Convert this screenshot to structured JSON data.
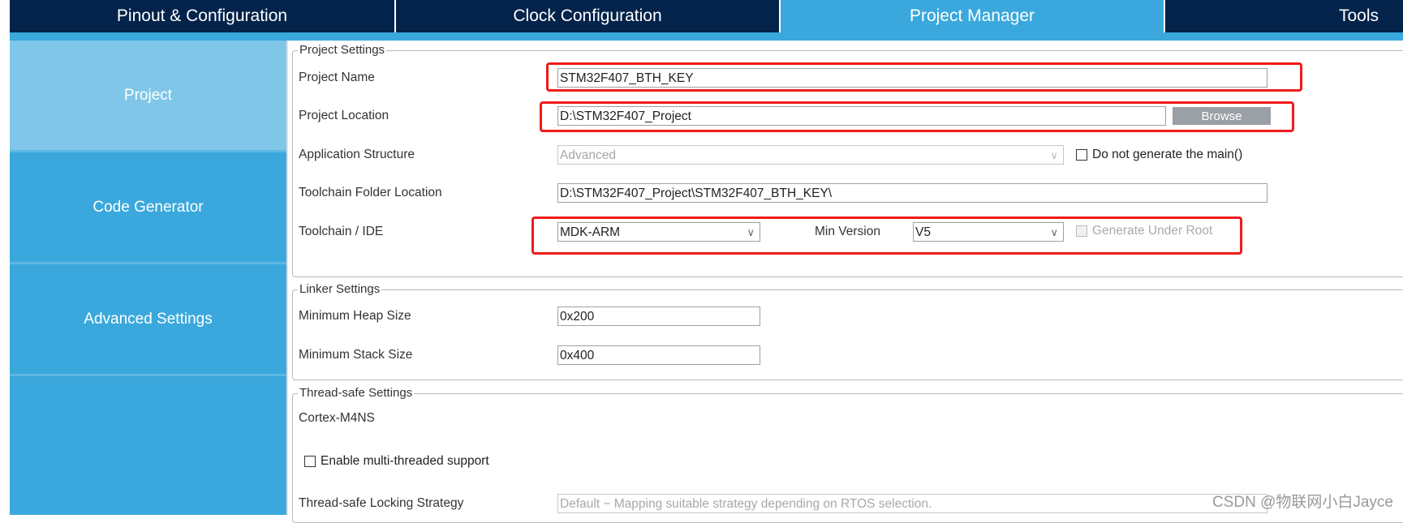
{
  "tabs": [
    {
      "label": "Pinout & Configuration"
    },
    {
      "label": "Clock Configuration"
    },
    {
      "label": "Project Manager",
      "active": true
    },
    {
      "label": "Tools"
    }
  ],
  "sidebar": {
    "items": [
      {
        "label": "Project",
        "active": true
      },
      {
        "label": "Code Generator"
      },
      {
        "label": "Advanced Settings"
      }
    ]
  },
  "project_settings": {
    "legend": "Project Settings",
    "project_name": {
      "label": "Project Name",
      "value": "STM32F407_BTH_KEY"
    },
    "project_location": {
      "label": "Project Location",
      "value": "D:\\STM32F407_Project",
      "browse": "Browse"
    },
    "application_structure": {
      "label": "Application Structure",
      "value": "Advanced",
      "checkbox": "Do not generate the main()",
      "checked": false
    },
    "toolchain_folder": {
      "label": "Toolchain Folder Location",
      "value": "D:\\STM32F407_Project\\STM32F407_BTH_KEY\\"
    },
    "toolchain_ide": {
      "label": "Toolchain / IDE",
      "value": "MDK-ARM",
      "min_version_label": "Min Version",
      "min_version": "V5",
      "generate_under_root": "Generate Under Root",
      "checked": false
    }
  },
  "linker_settings": {
    "legend": "Linker Settings",
    "heap": {
      "label": "Minimum Heap Size",
      "value": "0x200"
    },
    "stack": {
      "label": "Minimum Stack Size",
      "value": "0x400"
    }
  },
  "thread_safe": {
    "legend": "Thread-safe Settings",
    "core": "Cortex-M4NS",
    "multithread": "Enable multi-threaded support",
    "checked": false,
    "locking_label": "Thread-safe Locking Strategy",
    "locking_value": "Default  −  Mapping suitable strategy depending on RTOS selection."
  },
  "highlight_color": "#f01a1a",
  "accent": "#3aa8dc",
  "watermark": "CSDN @物联网小白Jayce"
}
